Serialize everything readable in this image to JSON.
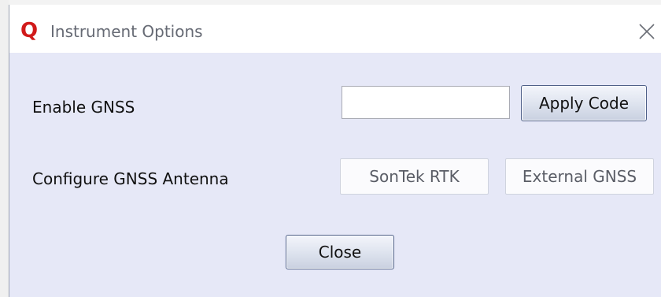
{
  "window": {
    "app_icon_glyph": "Q",
    "title": "Instrument Options",
    "close_glyph": "×"
  },
  "gnss": {
    "label": "Enable GNSS",
    "code_input_value": "",
    "code_input_placeholder": "",
    "apply_label": "Apply Code"
  },
  "antenna": {
    "label": "Configure GNSS Antenna",
    "sontek_label": "SonTek RTK",
    "external_label": "External GNSS"
  },
  "footer": {
    "close_label": "Close"
  },
  "colors": {
    "brand_red": "#d11a1a",
    "dialog_bg": "#e6e8f7",
    "titlebar_bg": "#ffffff"
  }
}
